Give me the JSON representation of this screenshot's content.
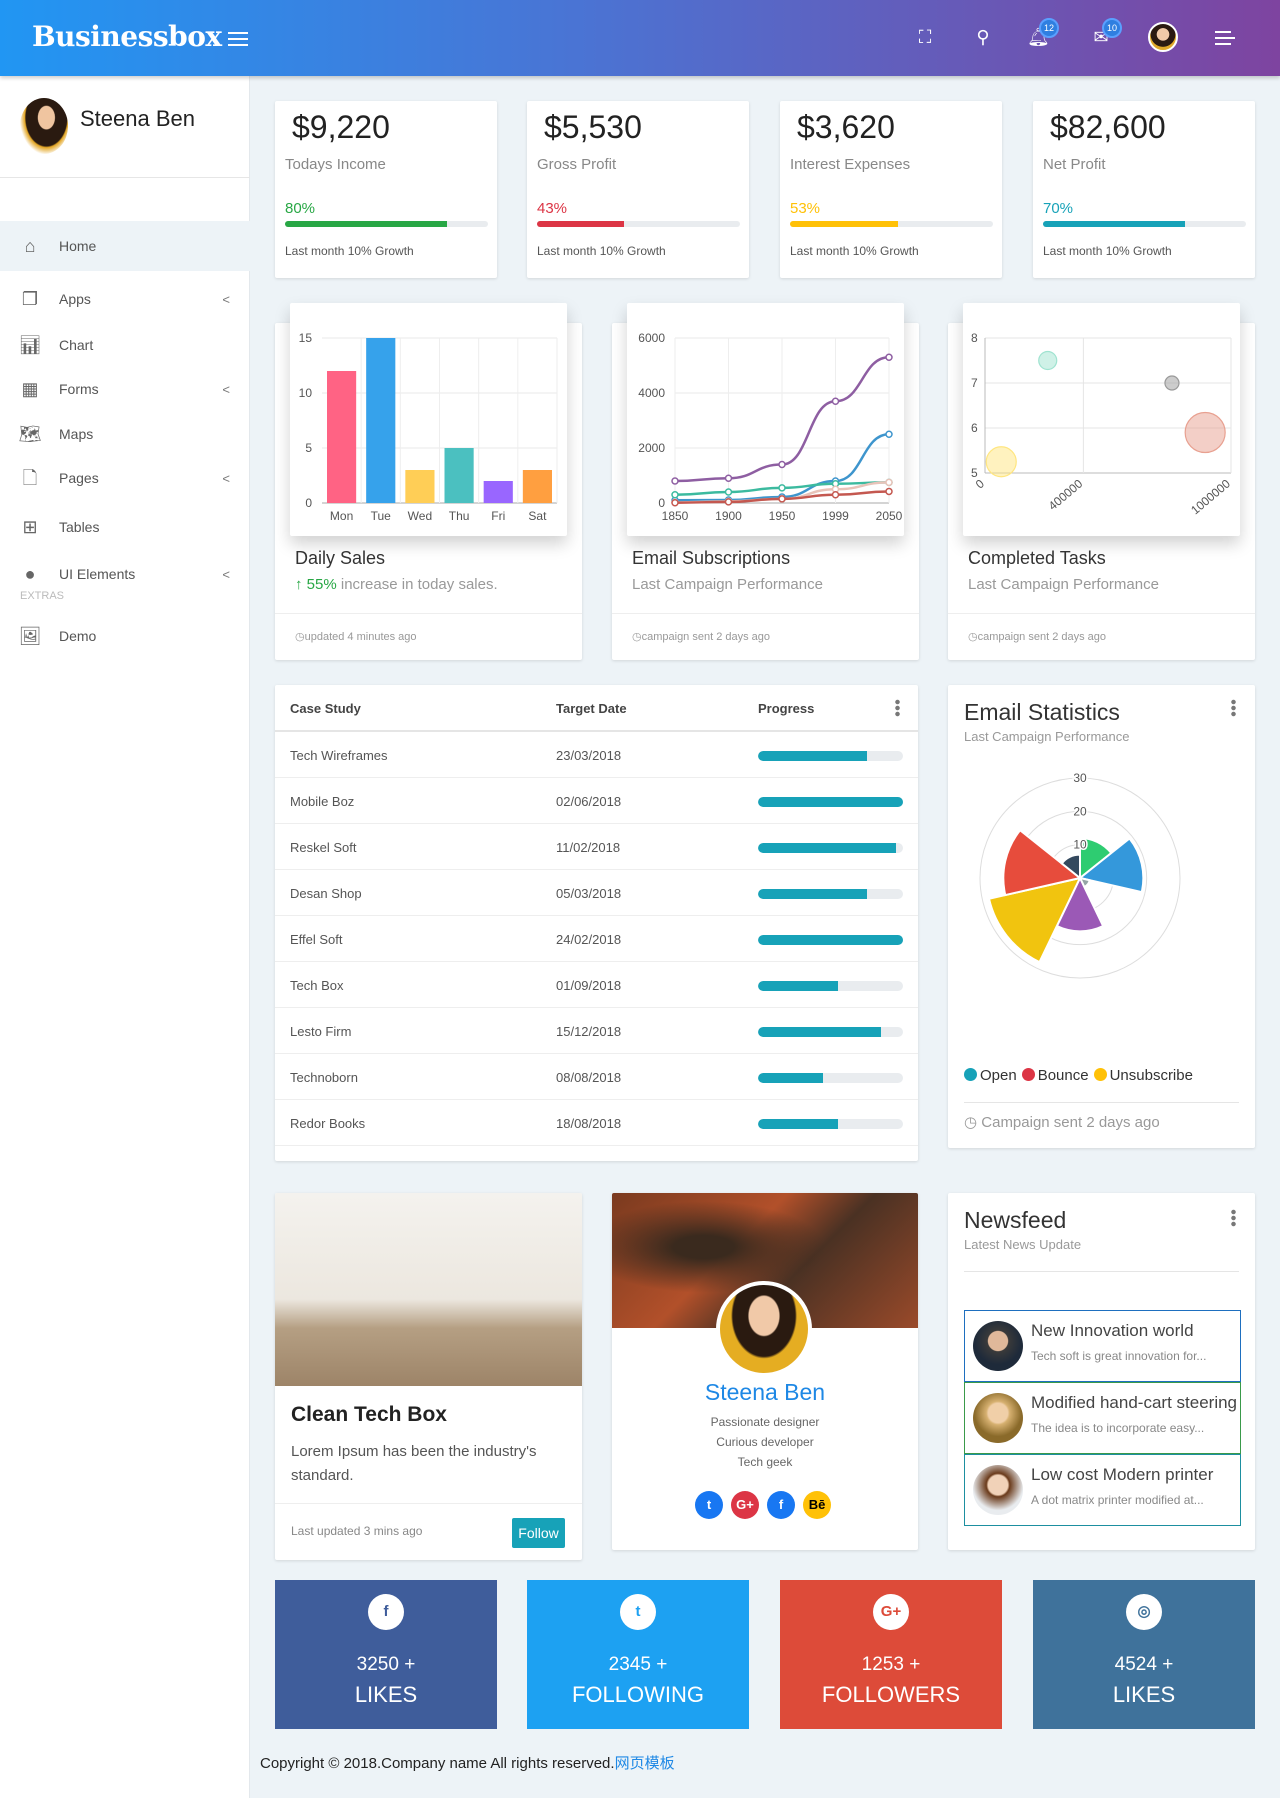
{
  "header": {
    "brand": "Businessbox",
    "notifications_count": "12",
    "messages_count": "10",
    "icons": [
      "menu-icon",
      "fullscreen-icon",
      "search-icon",
      "bell-icon",
      "mail-icon",
      "avatar",
      "menu-icon"
    ],
    "gradient": [
      "#2196f3",
      "#7e44a0"
    ]
  },
  "sidebar": {
    "user_name": "Steena Ben",
    "section_label": "EXTRAS",
    "items": [
      {
        "label": "Home",
        "icon": "home-icon",
        "active": true
      },
      {
        "label": "Apps",
        "icon": "apps-icon",
        "chevron": true
      },
      {
        "label": "Chart",
        "icon": "bar-chart-icon"
      },
      {
        "label": "Forms",
        "icon": "building-icon",
        "chevron": true
      },
      {
        "label": "Maps",
        "icon": "map-icon"
      },
      {
        "label": "Pages",
        "icon": "file-icon",
        "chevron": true
      },
      {
        "label": "Tables",
        "icon": "grid-icon"
      },
      {
        "label": "UI Elements",
        "icon": "globe-icon",
        "chevron": true
      }
    ],
    "extras": [
      {
        "label": "Demo",
        "icon": "image-icon"
      }
    ]
  },
  "stats": [
    {
      "value": "$9,220",
      "label": "Todays Income",
      "percent": "80%",
      "progress": 80,
      "color": "#28a745",
      "note": "Last month 10% Growth"
    },
    {
      "value": "$5,530",
      "label": "Gross Profit",
      "percent": "43%",
      "progress": 43,
      "color": "#dc3545",
      "note": "Last month 10% Growth"
    },
    {
      "value": "$3,620",
      "label": "Interest Expenses",
      "percent": "53%",
      "progress": 53,
      "color": "#ffc107",
      "note": "Last month 10% Growth"
    },
    {
      "value": "$82,600",
      "label": "Net Profit",
      "percent": "70%",
      "progress": 70,
      "color": "#17a2b8",
      "note": "Last month 10% Growth"
    }
  ],
  "chart_cards": [
    {
      "title": "Daily Sales",
      "highlight": "55%",
      "subtitle": "increase in today sales.",
      "footer": "updated 4 minutes ago"
    },
    {
      "title": "Email Subscriptions",
      "subtitle": "Last Campaign Performance",
      "footer": "campaign sent 2 days ago"
    },
    {
      "title": "Completed Tasks",
      "subtitle": "Last Campaign Performance",
      "footer": "campaign sent 2 days ago"
    }
  ],
  "chart_data": [
    {
      "type": "bar",
      "categories": [
        "Mon",
        "Tue",
        "Wed",
        "Thu",
        "Fri",
        "Sat"
      ],
      "values": [
        12,
        15,
        3,
        5,
        2,
        3
      ],
      "colors": [
        "#ff6384",
        "#36a2eb",
        "#ffce56",
        "#4bc0c0",
        "#9966ff",
        "#ff9f40"
      ],
      "ylim": [
        0,
        15
      ],
      "yticks": [
        0,
        5,
        10,
        15
      ],
      "grid": true
    },
    {
      "type": "line",
      "categories": [
        "1850",
        "1900",
        "1950",
        "1999",
        "2050"
      ],
      "ylim": [
        0,
        6000
      ],
      "yticks": [
        0,
        2000,
        4000,
        6000
      ],
      "grid": true,
      "series": [
        {
          "values": [
            800,
            900,
            1400,
            3700,
            5300
          ],
          "color": "#8e5ea2"
        },
        {
          "values": [
            100,
            110,
            220,
            800,
            2500
          ],
          "color": "#3e95cd"
        },
        {
          "values": [
            300,
            400,
            550,
            700,
            750
          ],
          "color": "#3cba9f"
        },
        {
          "values": [
            20,
            60,
            150,
            500,
            750
          ],
          "color": "#e8c3b9"
        },
        {
          "values": [
            10,
            40,
            150,
            300,
            420
          ],
          "color": "#c45850"
        }
      ]
    },
    {
      "type": "scatter",
      "subtype": "bubble",
      "xlim": [
        0,
        1000000
      ],
      "ylim": [
        5,
        8
      ],
      "xticks": [
        0,
        400000,
        1000000
      ],
      "yticks": [
        5,
        6,
        7,
        8
      ],
      "grid": true,
      "points": [
        {
          "x": 66000,
          "y": 5.25,
          "r": 15,
          "color": "#ffe680"
        },
        {
          "x": 255000,
          "y": 7.5,
          "r": 9,
          "color": "#9fe3d0"
        },
        {
          "x": 760000,
          "y": 7,
          "r": 7,
          "color": "#999999"
        },
        {
          "x": 895000,
          "y": 5.9,
          "r": 20,
          "color": "#e8a090"
        }
      ]
    },
    {
      "type": "polarArea",
      "values": [
        12,
        19,
        3,
        16,
        28,
        23,
        7
      ],
      "rlim": [
        0,
        30
      ],
      "rticks": [
        10,
        20,
        30
      ],
      "colors": [
        "#2ecc71",
        "#3498db",
        "#95a5a6",
        "#9b59b6",
        "#f1c40f",
        "#e74c3c",
        "#34495e"
      ],
      "legend": [
        {
          "label": "Open",
          "color": "#17a2b8"
        },
        {
          "label": "Bounce",
          "color": "#dc3545"
        },
        {
          "label": "Unsubscribe",
          "color": "#ffc107"
        }
      ]
    }
  ],
  "table": {
    "columns": [
      "Case Study",
      "Target Date",
      "Progress"
    ],
    "rows": [
      {
        "name": "Tech Wireframes",
        "date": "23/03/2018",
        "progress": 75
      },
      {
        "name": "Mobile Boz",
        "date": "02/06/2018",
        "progress": 100
      },
      {
        "name": "Reskel Soft",
        "date": "11/02/2018",
        "progress": 95
      },
      {
        "name": "Desan Shop",
        "date": "05/03/2018",
        "progress": 75
      },
      {
        "name": "Effel Soft",
        "date": "24/02/2018",
        "progress": 100
      },
      {
        "name": "Tech Box",
        "date": "01/09/2018",
        "progress": 55
      },
      {
        "name": "Lesto Firm",
        "date": "15/12/2018",
        "progress": 85
      },
      {
        "name": "Technoborn",
        "date": "08/08/2018",
        "progress": 45
      },
      {
        "name": "Redor Books",
        "date": "18/08/2018",
        "progress": 55
      }
    ]
  },
  "email_stats": {
    "title": "Email Statistics",
    "subtitle": "Last Campaign Performance",
    "footer": "Campaign sent 2 days ago"
  },
  "blog_card": {
    "title": "Clean Tech Box",
    "text": "Lorem Ipsum has been the industry's standard.",
    "footer": "Last updated 3 mins ago",
    "button": "Follow"
  },
  "profile_card": {
    "name": "Steena Ben",
    "lines": [
      "Passionate designer",
      "Curious developer",
      "Tech geek"
    ],
    "socials": [
      {
        "label": "t",
        "icon": "twitter-icon",
        "color": "#1877f2"
      },
      {
        "label": "G+",
        "icon": "google-plus-icon",
        "color": "#dc3545"
      },
      {
        "label": "f",
        "icon": "facebook-icon",
        "color": "#1877f2"
      },
      {
        "label": "Bē",
        "icon": "behance-icon",
        "color": "#ffc107"
      }
    ]
  },
  "newsfeed": {
    "title": "Newsfeed",
    "subtitle": "Latest News Update",
    "items": [
      {
        "title": "New Innovation world",
        "text": "Tech soft is great innovation for...",
        "border": "#1e6fbf"
      },
      {
        "title": "Modified hand-cart steering",
        "text": "The idea is to incorporate easy...",
        "border": "#3a9a4a"
      },
      {
        "title": "Low cost Modern printer",
        "text": "A dot matrix printer modified at...",
        "border": "#1d8fa0"
      }
    ]
  },
  "social_tiles": [
    {
      "icon": "facebook-icon",
      "glyph": "f",
      "count": "3250 +",
      "label": "LIKES",
      "color": "#3f5d9b"
    },
    {
      "icon": "twitter-icon",
      "glyph": "t",
      "count": "2345 +",
      "label": "FOLLOWING",
      "color": "#1da1f2"
    },
    {
      "icon": "google-plus-icon",
      "glyph": "G+",
      "count": "1253 +",
      "label": "FOLLOWERS",
      "color": "#dd4b39"
    },
    {
      "icon": "instagram-icon",
      "glyph": "◎",
      "count": "4524 +",
      "label": "LIKES",
      "color": "#3f729b"
    }
  ],
  "footer": {
    "text": "Copyright © 2018.Company name All rights reserved.",
    "link": "网页模板"
  }
}
